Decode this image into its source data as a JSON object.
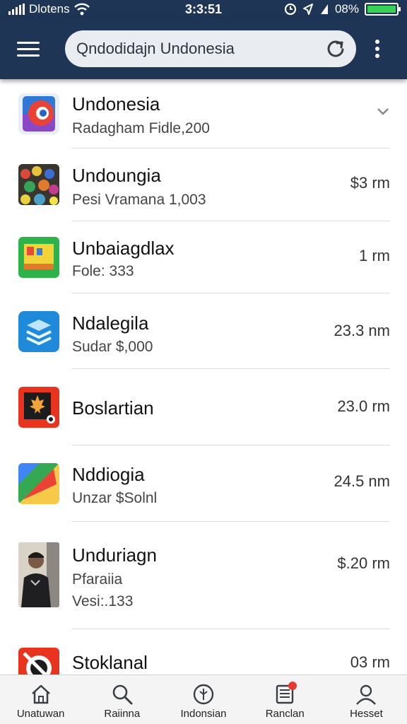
{
  "status_bar": {
    "carrier": "Dlotens",
    "time": "3:3:51",
    "battery_percent": "08%",
    "battery_level": 1.0
  },
  "app_bar": {
    "search_text": "Qndodidajn Undonesia",
    "menu_icon": "menu-icon",
    "refresh_icon": "refresh-icon",
    "more_icon": "more-vert-icon"
  },
  "list": {
    "items": [
      {
        "title": "Undonesia",
        "subtitle": "Radagham Fidle,200",
        "meta": "",
        "icon": "chrome-like-app-icon"
      },
      {
        "title": "Undoungia",
        "subtitle": "Pesi Vramana 1,003",
        "meta": "$3 rm",
        "icon": "crowd-photo-icon"
      },
      {
        "title": "Unbaiagdlax",
        "subtitle": "Fole: 333",
        "meta": "1 rm",
        "icon": "green-board-icon"
      },
      {
        "title": "Ndalegila",
        "subtitle": "Sudar $,000",
        "meta": "23.3 nm",
        "icon": "stack-layers-icon"
      },
      {
        "title": "Boslartian",
        "subtitle": "",
        "meta": "23.0 rm",
        "icon": "maple-leaf-icon"
      },
      {
        "title": "Nddiogia",
        "subtitle": "Unzar $Solnl",
        "meta": "24.5 nm",
        "icon": "colorful-shape-icon"
      },
      {
        "title": "Unduriagn",
        "subtitle": "Pfaraiia",
        "subtitle2": "Vesi:.133",
        "meta": "$.20 rm",
        "icon": "person-photo-icon"
      },
      {
        "title": "Stoklanal",
        "subtitle": "",
        "meta": "03 rm",
        "icon": "red-circle-icon"
      }
    ]
  },
  "bottom_nav": {
    "items": [
      {
        "label": "Unatuwan",
        "icon": "home-icon"
      },
      {
        "label": "Raiinna",
        "icon": "search-icon"
      },
      {
        "label": "Indonsian",
        "icon": "compass-icon"
      },
      {
        "label": "Ranclan",
        "icon": "news-icon",
        "badge": true
      },
      {
        "label": "Hesset",
        "icon": "account-icon"
      }
    ]
  },
  "colors": {
    "app_bar": "#1f3556",
    "background": "#ffffff",
    "battery": "#38d158",
    "badge": "#e53935"
  }
}
